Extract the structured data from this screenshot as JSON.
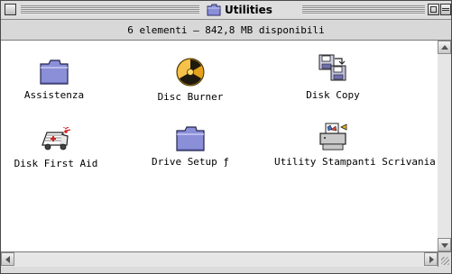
{
  "window": {
    "title": "Utilities",
    "title_icon": "folder-icon"
  },
  "info_bar": {
    "text": "6 elementi – 842,8 MB disponibili"
  },
  "items": [
    {
      "label": "Assistenza",
      "icon": "folder-icon"
    },
    {
      "label": "Disc Burner",
      "icon": "radiation-disc-icon"
    },
    {
      "label": "Disk Copy",
      "icon": "disk-copy-icon"
    },
    {
      "label": "Disk First Aid",
      "icon": "ambulance-icon"
    },
    {
      "label": "Drive Setup ƒ",
      "icon": "folder-icon"
    },
    {
      "label": "Utility Stampanti Scrivania",
      "icon": "printer-icon"
    }
  ],
  "colors": {
    "folder": "#8a8fd8",
    "window_chrome": "#dcdcdc"
  }
}
